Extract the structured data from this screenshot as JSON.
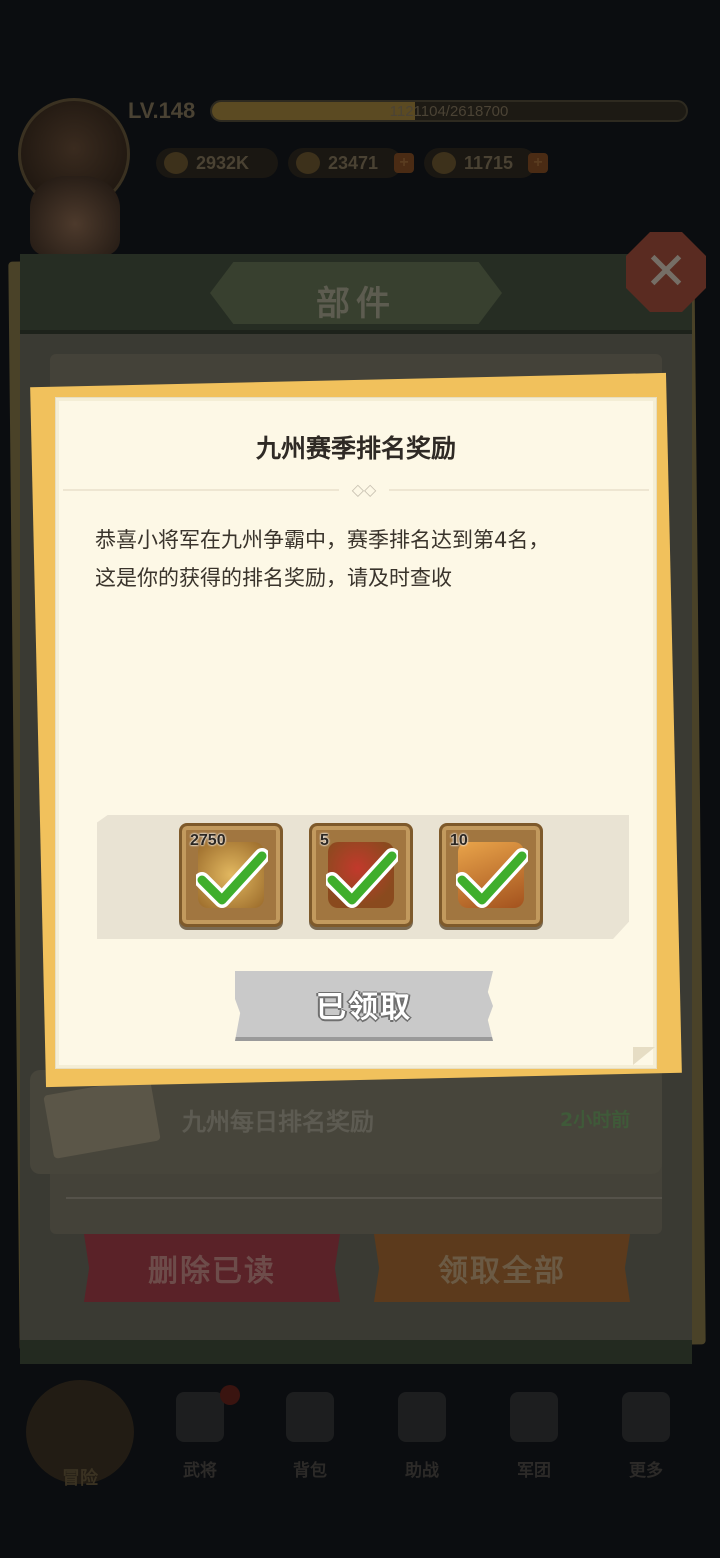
{
  "hud": {
    "level": "LV.148",
    "xp_text": "1121104/2618700",
    "xp_progress": 0.428,
    "power": "2932K",
    "gold": "23471",
    "food": "11715"
  },
  "panel": {
    "title": "部件",
    "mail_item": {
      "title": "九州每日排名奖励",
      "time": "2小时前"
    },
    "delete_read_label": "删除已读",
    "claim_all_label": "领取全部"
  },
  "dialog": {
    "title": "九州赛季排名奖励",
    "body_line1": "恭喜小将军在九州争霸中，赛季排名达到第4名，",
    "body_line2": "这是你的获得的排名奖励，请及时查收",
    "rewards": [
      {
        "icon": "crossed-swords-emblem-icon",
        "quantity": "2750",
        "claimed": true
      },
      {
        "icon": "red-gem-pouch-icon",
        "quantity": "5",
        "claimed": true
      },
      {
        "icon": "treasure-chest-icon",
        "quantity": "10",
        "claimed": true
      }
    ],
    "claimed_label": "已领取"
  },
  "nav": {
    "home_label": "冒险",
    "items": [
      "武将",
      "背包",
      "助战",
      "军团",
      "更多"
    ]
  },
  "colors": {
    "paper": "#fdf8e6",
    "dialog_border": "#f1c15c",
    "check_green": "#3fae2c",
    "reward_frame": "#a17640"
  }
}
